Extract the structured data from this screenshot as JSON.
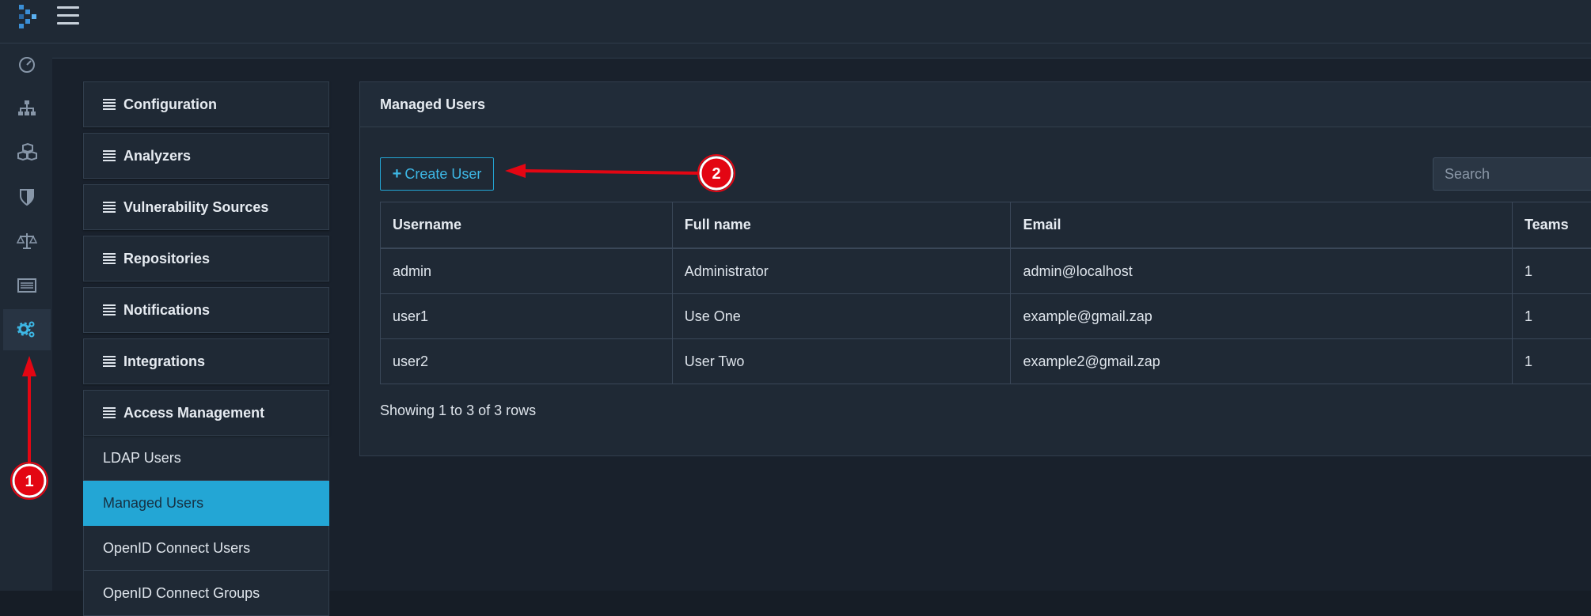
{
  "nav": {
    "items": [
      {
        "name": "dashboard",
        "icon": "speedometer-icon"
      },
      {
        "name": "projects",
        "icon": "sitemap-icon"
      },
      {
        "name": "components",
        "icon": "cubes-icon"
      },
      {
        "name": "vulnerabilities",
        "icon": "shield-icon"
      },
      {
        "name": "policy",
        "icon": "balance-scale-icon"
      },
      {
        "name": "licenses",
        "icon": "list-alt-icon"
      },
      {
        "name": "administration",
        "icon": "cogs-icon"
      }
    ]
  },
  "admin_menu": {
    "sections": [
      {
        "label": "Configuration"
      },
      {
        "label": "Analyzers"
      },
      {
        "label": "Vulnerability Sources"
      },
      {
        "label": "Repositories"
      },
      {
        "label": "Notifications"
      },
      {
        "label": "Integrations"
      },
      {
        "label": "Access Management"
      }
    ],
    "access_items": [
      {
        "label": "LDAP Users",
        "active": false
      },
      {
        "label": "Managed Users",
        "active": true
      },
      {
        "label": "OpenID Connect Users",
        "active": false
      },
      {
        "label": "OpenID Connect Groups",
        "active": false
      }
    ]
  },
  "card": {
    "title": "Managed Users",
    "create_button": "Create User",
    "search_placeholder": "Search",
    "columns": [
      "Username",
      "Full name",
      "Email",
      "Teams"
    ],
    "rows": [
      [
        "admin",
        "Administrator",
        "admin@localhost",
        "1"
      ],
      [
        "user1",
        "Use One",
        "example@gmail.zap",
        "1"
      ],
      [
        "user2",
        "User Two",
        "example2@gmail.zap",
        "1"
      ]
    ],
    "footer": "Showing 1 to 3 of 3 rows"
  },
  "annotations": {
    "marker1": "1",
    "marker2": "2",
    "color": "#e30613"
  },
  "colors": {
    "accent": "#23a6d5",
    "background": "#161d26",
    "panel": "#1f2935"
  }
}
